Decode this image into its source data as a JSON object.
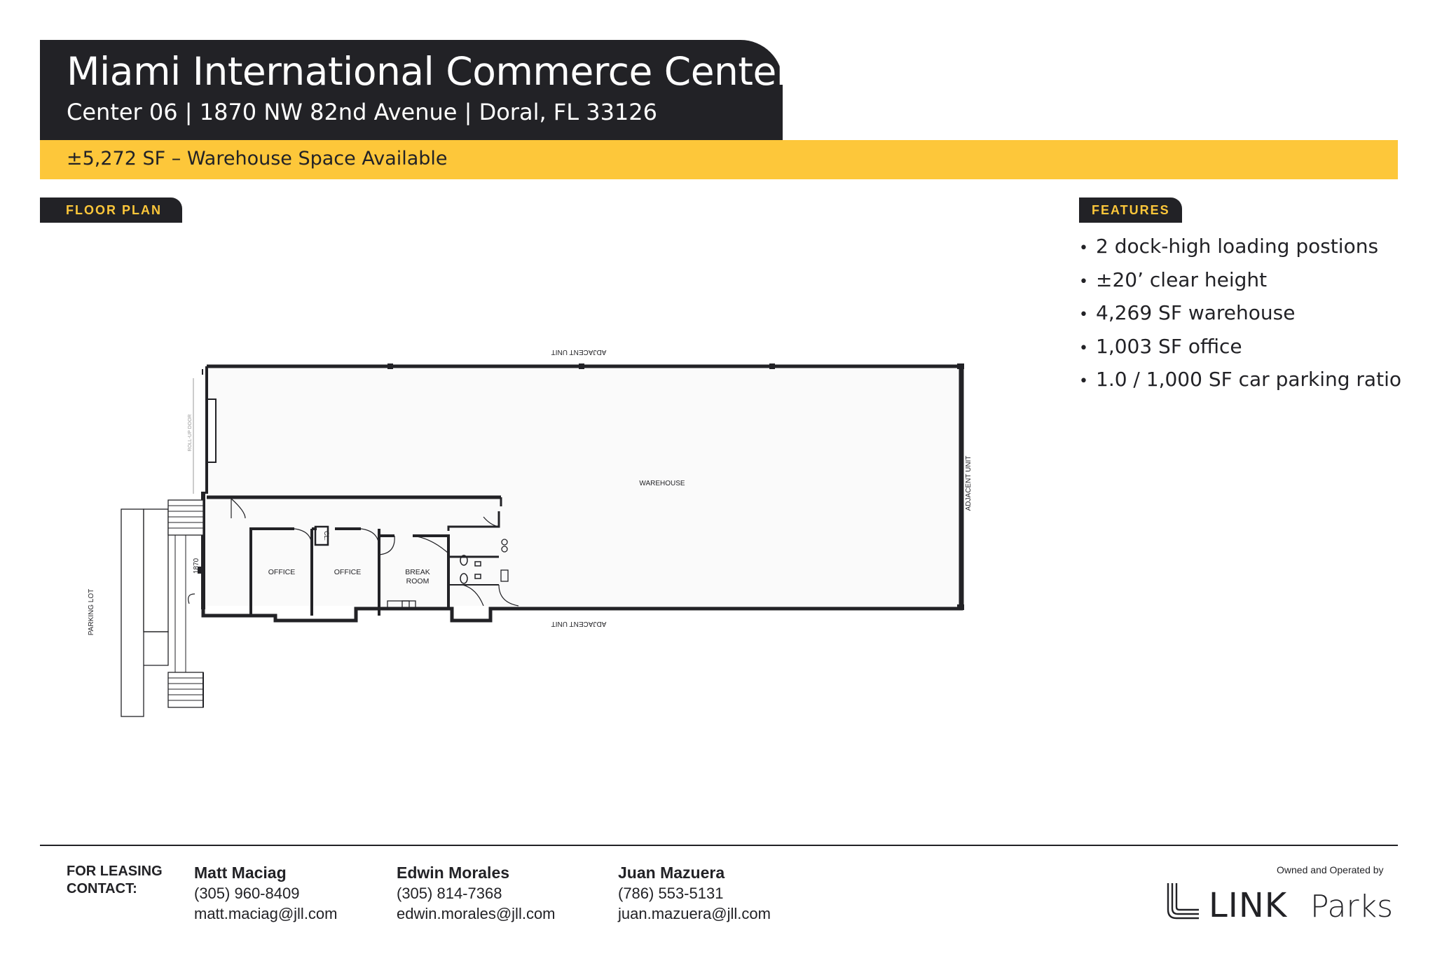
{
  "header": {
    "title": "Miami International Commerce Center",
    "subtitle": "Center 06 | 1870 NW 82nd Avenue | Doral, FL 33126"
  },
  "availability": "±5,272 SF  – Warehouse Space Available",
  "floor_plan": {
    "tag": "FLOOR PLAN",
    "labels": {
      "adjacent_top": "ADJACENT UNIT",
      "adjacent_right": "ADJACENT UNIT",
      "adjacent_bottom": "ADJACENT UNIT",
      "warehouse": "WAREHOUSE",
      "office_1": "OFFICE",
      "office_2": "OFFICE",
      "break_room_1": "BREAK",
      "break_room_2": "ROOM",
      "closet": "CL.",
      "address_number": "1870",
      "parking_lot": "PARKING LOT",
      "roll_up_door": "ROLL-UP DOOR"
    }
  },
  "features": {
    "tag": "FEATURES",
    "bullet": "•",
    "items": [
      "2 dock-high loading postions",
      "±20’ clear height",
      "4,269 SF warehouse",
      "1,003 SF office",
      "1.0 / 1,000 SF car parking ratio"
    ]
  },
  "footer": {
    "leasing_label_1": "FOR LEASING",
    "leasing_label_2": "CONTACT:",
    "contacts": [
      {
        "name": "Matt Maciag",
        "phone": "(305) 960-8409",
        "email": "matt.maciag@jll.com"
      },
      {
        "name": "Edwin Morales",
        "phone": "(305) 814-7368",
        "email": "edwin.morales@jll.com"
      },
      {
        "name": "Juan Mazuera",
        "phone": "(786) 553-5131",
        "email": "juan.mazuera@jll.com"
      }
    ],
    "owned_text": "Owned and Operated by",
    "logo_text_1": "LINK",
    "logo_text_2": "Parks"
  },
  "colors": {
    "dark": "#222226",
    "accent_yellow": "#fdc73a",
    "background": "#ffffff"
  }
}
